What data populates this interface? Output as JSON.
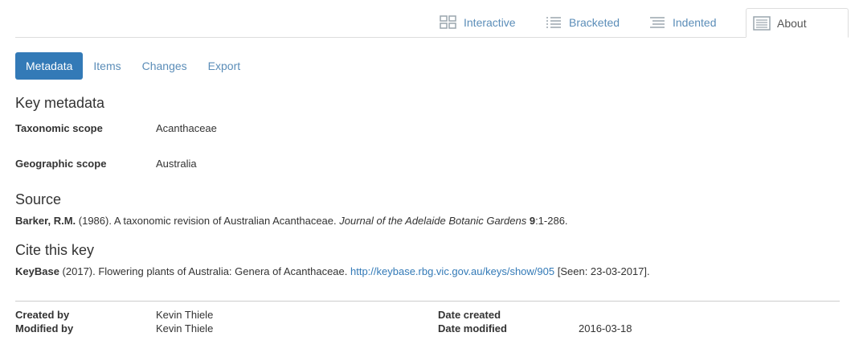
{
  "view_tabs": [
    {
      "label": "Interactive",
      "icon": "grid-icon"
    },
    {
      "label": "Bracketed",
      "icon": "list-icon"
    },
    {
      "label": "Indented",
      "icon": "indented-list-icon"
    },
    {
      "label": "About",
      "icon": "document-icon",
      "active": true
    }
  ],
  "pills": [
    {
      "label": "Metadata",
      "active": true
    },
    {
      "label": "Items"
    },
    {
      "label": "Changes"
    },
    {
      "label": "Export"
    }
  ],
  "key_metadata": {
    "heading": "Key metadata",
    "taxonomic_scope_label": "Taxonomic scope",
    "taxonomic_scope_value": "Acanthaceae",
    "geographic_scope_label": "Geographic scope",
    "geographic_scope_value": "Australia"
  },
  "source": {
    "heading": "Source",
    "author": "Barker, R.M.",
    "text_before": " (1986). A taxonomic revision of Australian Acanthaceae. ",
    "journal": "Journal of the Adelaide Botanic Gardens",
    "text_space": " ",
    "volume": "9",
    "pages": ":1-286."
  },
  "cite": {
    "heading": "Cite this key",
    "org": "KeyBase",
    "text": " (2017). Flowering plants of Australia: Genera of Acanthaceae. ",
    "url": "http://keybase.rbg.vic.gov.au/keys/show/905",
    "seen": " [Seen: 23-03-2017]."
  },
  "footer": {
    "created_by_label": "Created by",
    "created_by_value": "Kevin Thiele",
    "modified_by_label": "Modified by",
    "modified_by_value": "Kevin Thiele",
    "date_created_label": "Date created",
    "date_created_value": "",
    "date_modified_label": "Date modified",
    "date_modified_value": "2016-03-18"
  },
  "colors": {
    "accent": "#337ab7",
    "link": "#5b8db8",
    "icon_gray": "#9aa5ad"
  }
}
